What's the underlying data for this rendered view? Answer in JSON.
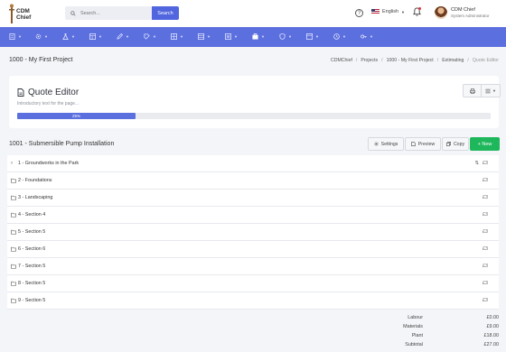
{
  "header": {
    "logo_text_1": "CDM",
    "logo_text_2": "Chief",
    "search_placeholder": "Search...",
    "search_button": "Search",
    "help_icon": "?",
    "language": "English",
    "user_name": "CDM Chief",
    "user_role": "System Administrator"
  },
  "menu": {
    "items": [
      {
        "icon": "document-icon"
      },
      {
        "icon": "gear-icon"
      },
      {
        "icon": "flask-icon"
      },
      {
        "icon": "table-icon"
      },
      {
        "icon": "pencil-icon"
      },
      {
        "icon": "paint-icon"
      },
      {
        "icon": "grid-icon"
      },
      {
        "icon": "briefcase-icon"
      },
      {
        "icon": "shield-icon"
      },
      {
        "icon": "layout-icon"
      },
      {
        "icon": "clock-icon"
      },
      {
        "icon": "key-icon"
      }
    ]
  },
  "page": {
    "title": "1000 - My First Project",
    "breadcrumb": [
      "CDMChief",
      "Projects",
      "1000 - My First Project",
      "Estimating",
      "Quote Editor"
    ]
  },
  "quote_editor": {
    "title": "Quote Editor",
    "intro": "Introductory text for the page...",
    "progress_label": "25%",
    "progress_value": 0.25
  },
  "section": {
    "title": "1001 - Submersible Pump Installation",
    "settings_label": "Settings",
    "preview_label": "Preview",
    "copy_label": "Copy",
    "new_label": "+ New"
  },
  "rows": [
    {
      "label": "1 - Groundworks in the Park",
      "value": "£3",
      "expandable": true
    },
    {
      "label": "2 - Foundations",
      "value": "£3",
      "expandable": false
    },
    {
      "label": "3 - Landscaping",
      "value": "£3",
      "expandable": false
    },
    {
      "label": "4 - Section 4",
      "value": "£3",
      "expandable": false
    },
    {
      "label": "5 - Section 5",
      "value": "£3",
      "expandable": false
    },
    {
      "label": "6 - Section 6",
      "value": "£3",
      "expandable": false
    },
    {
      "label": "7 - Section 5",
      "value": "£3",
      "expandable": false
    },
    {
      "label": "8 - Section 5",
      "value": "£3",
      "expandable": false
    },
    {
      "label": "9 - Section 5",
      "value": "£3",
      "expandable": false
    }
  ],
  "totals": [
    {
      "label": "Labour",
      "value": "£0.00"
    },
    {
      "label": "Materials",
      "value": "£9.00"
    },
    {
      "label": "Plant",
      "value": "£18.00"
    },
    {
      "label": "Subtotal",
      "value": "£27.00"
    }
  ],
  "colors": {
    "accent": "#5c6fdf",
    "success": "#1eb75b"
  }
}
